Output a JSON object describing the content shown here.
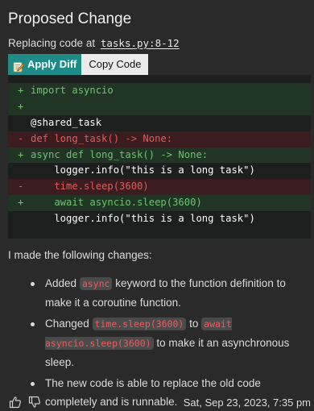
{
  "title": "Proposed Change",
  "subtitle": {
    "prefix": "Replacing code at",
    "path": "tasks.py:8-12"
  },
  "buttons": {
    "apply": "Apply Diff",
    "copy": "Copy Code"
  },
  "code_lines": [
    {
      "type": "add",
      "sign": "+",
      "text": "import asyncio"
    },
    {
      "type": "add",
      "sign": "+",
      "text": ""
    },
    {
      "type": "ctx",
      "sign": "",
      "text": "@shared_task"
    },
    {
      "type": "del",
      "sign": "-",
      "text": "def long_task() -> None:"
    },
    {
      "type": "add",
      "sign": "+",
      "text": "async def long_task() -> None:"
    },
    {
      "type": "ctx",
      "sign": "",
      "text": "    logger.info(\"this is a long task\")"
    },
    {
      "type": "del",
      "sign": "-",
      "text": "    time.sleep(3600)"
    },
    {
      "type": "add",
      "sign": "+",
      "text": "    await asyncio.sleep(3600)"
    },
    {
      "type": "ctx",
      "sign": "",
      "text": "    logger.info(\"this is a long task\")"
    }
  ],
  "intro": "I made the following changes:",
  "changes": [
    {
      "a": "Added",
      "code1": "async",
      "b": "keyword to the function definition to make it a coroutine function."
    },
    {
      "a": "Changed",
      "code1": "time.sleep(3600)",
      "mid": "to",
      "code2": "await asyncio.sleep(3600)",
      "b": "to make it an asynchronous sleep."
    },
    {
      "a": "The new code is able to replace the old code completely and is runnable."
    }
  ],
  "timestamp": "Sat, Sep 23, 2023, 7:35 pm",
  "icons": {
    "apply": "pencil-memo-icon",
    "up": "thumbs-up-icon",
    "down": "thumbs-down-icon"
  },
  "colors": {
    "apply_bg": "#1f8b86",
    "add_fg": "#6ec46e",
    "del_fg": "#df5c5c",
    "inline_code_fg": "#ee5b5b"
  }
}
